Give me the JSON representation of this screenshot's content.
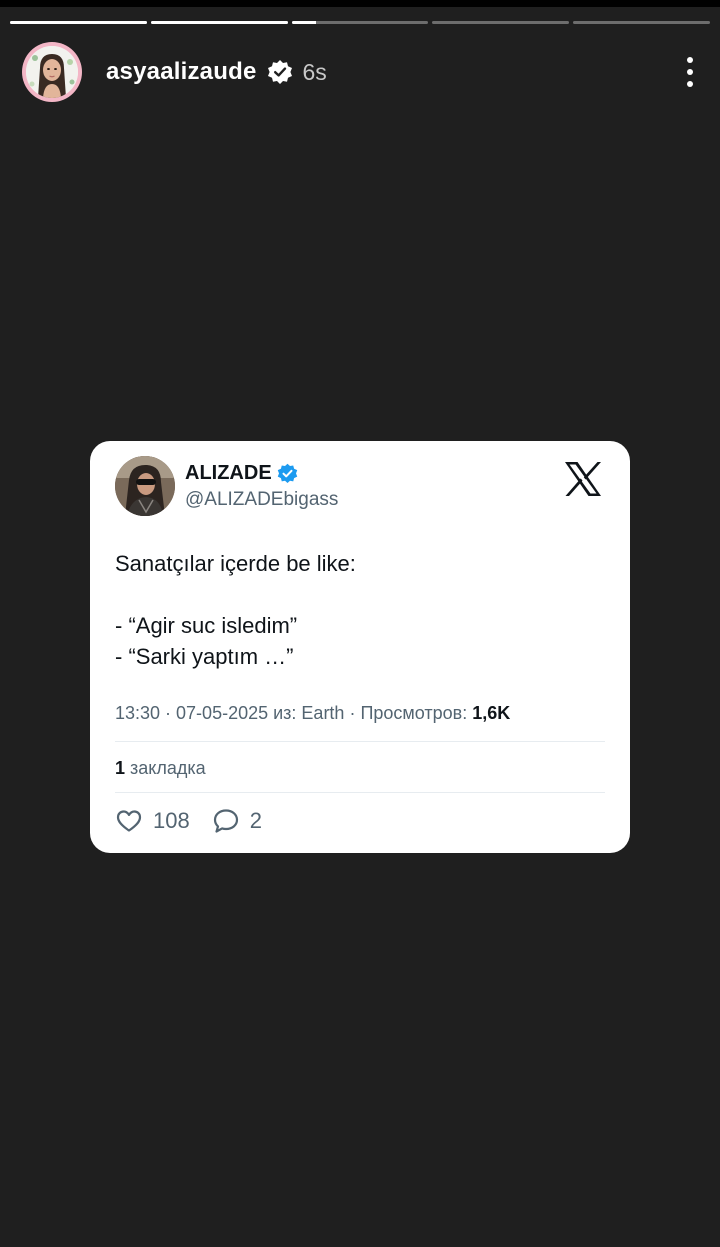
{
  "story": {
    "progress_segments": [
      1,
      1,
      0.18,
      0,
      0
    ],
    "username": "asyaalizaude",
    "time_ago": "6s",
    "icons": {
      "verified": "verified-badge-icon",
      "more": "more-vertical-icon"
    }
  },
  "tweet": {
    "name": "ALIZADE",
    "handle": "@ALIZADEbigass",
    "text": "Sanatçılar içerde be like:\n\n- “Agir suc isledim”\n- “Sarki yaptım …”",
    "meta_prefix": "13:30 · 07-05-2025 из: Earth · Просмотров: ",
    "views": "1,6K",
    "bookmarks_count": "1",
    "bookmarks_label": "закладка",
    "likes": "108",
    "replies": "2",
    "colors": {
      "verified_blue": "#1d9bf0",
      "text": "#0f1419",
      "secondary": "#536471"
    }
  }
}
